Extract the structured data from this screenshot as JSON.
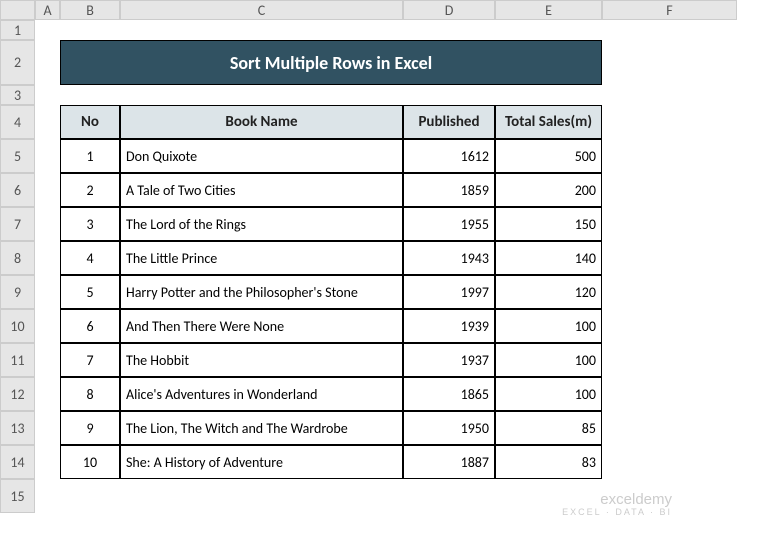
{
  "columns": [
    "A",
    "B",
    "C",
    "D",
    "E",
    "F"
  ],
  "rows": [
    "1",
    "2",
    "3",
    "4",
    "5",
    "6",
    "7",
    "8",
    "9",
    "10",
    "11",
    "12",
    "13",
    "14",
    "15"
  ],
  "title": "Sort Multiple Rows in Excel",
  "headers": {
    "no": "No",
    "book_name": "Book Name",
    "published": "Published",
    "total_sales": "Total Sales(m)"
  },
  "data": [
    {
      "no": "1",
      "name": "Don Quixote",
      "published": "1612",
      "sales": "500"
    },
    {
      "no": "2",
      "name": "A Tale of Two Cities",
      "published": "1859",
      "sales": "200"
    },
    {
      "no": "3",
      "name": "The Lord of the Rings",
      "published": "1955",
      "sales": "150"
    },
    {
      "no": "4",
      "name": "The Little Prince",
      "published": "1943",
      "sales": "140"
    },
    {
      "no": "5",
      "name": "Harry Potter and the Philosopher's Stone",
      "published": "1997",
      "sales": "120"
    },
    {
      "no": "6",
      "name": "And Then There Were None",
      "published": "1939",
      "sales": "100"
    },
    {
      "no": "7",
      "name": "The Hobbit",
      "published": "1937",
      "sales": "100"
    },
    {
      "no": "8",
      "name": "Alice's Adventures in Wonderland",
      "published": "1865",
      "sales": "100"
    },
    {
      "no": "9",
      "name": "The Lion, The Witch and The Wardrobe",
      "published": "1950",
      "sales": "85"
    },
    {
      "no": "10",
      "name": "She: A History of Adventure",
      "published": "1887",
      "sales": "83"
    }
  ],
  "watermark": {
    "main": "exceldemy",
    "sub": "EXCEL · DATA · BI"
  }
}
